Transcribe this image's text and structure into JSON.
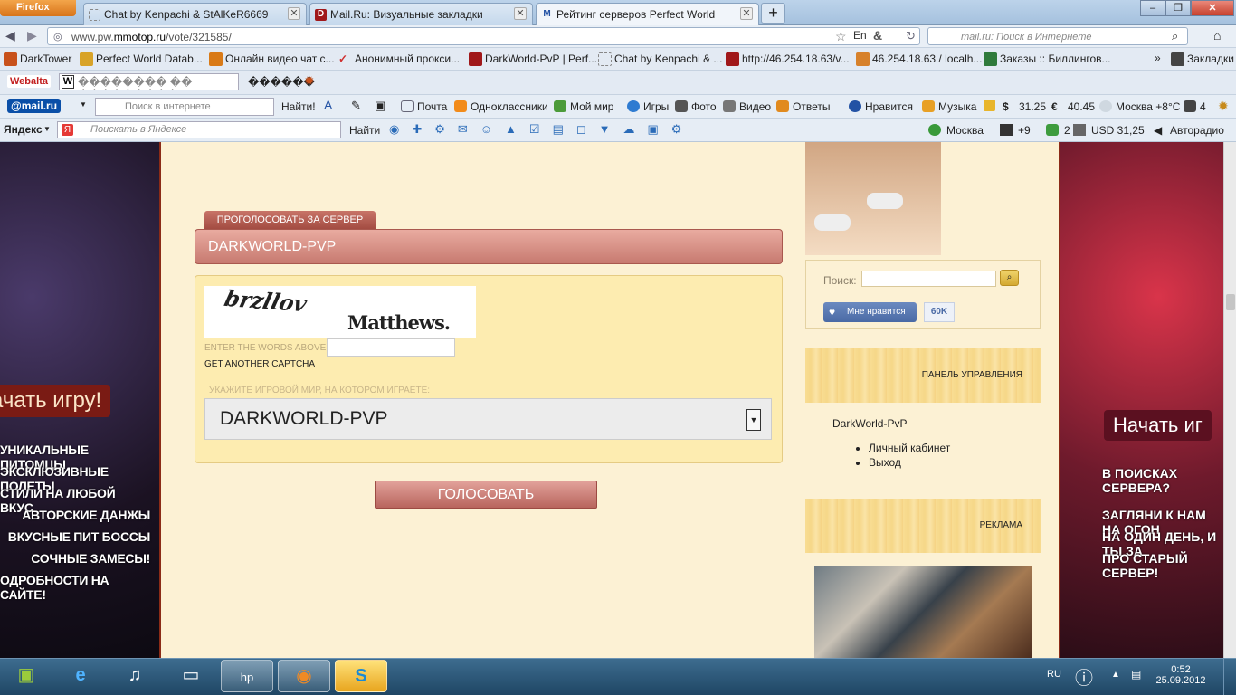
{
  "browser": {
    "menu_label": "Firefox",
    "tabs": [
      {
        "title": "Chat by Kenpachi & StAlKeR6669",
        "icon": "page-icon",
        "active": false
      },
      {
        "title": "Mail.Ru: Визуальные закладки",
        "icon": "dw-icon",
        "active": false
      },
      {
        "title": "Рейтинг серверов Perfect World",
        "icon": "m-icon",
        "active": true
      }
    ],
    "new_tab": "+",
    "window_buttons": [
      "–",
      "❐",
      "✕"
    ]
  },
  "navbar": {
    "url_prefix": "www.pw.",
    "url_domain": "mmotop.ru",
    "url_path": "/vote/321585/",
    "search_placeholder": "mail.ru: Поиск в Интернете"
  },
  "bookmarks": [
    {
      "label": "DarkTower",
      "color": "#c8511b"
    },
    {
      "label": "Perfect World Datab...",
      "color": "#d8a328"
    },
    {
      "label": "Онлайн видео чат с...",
      "color": "#d97a17"
    },
    {
      "label": "Анонимный прокси...",
      "color": "#cf2e2e"
    },
    {
      "label": "DarkWorld-PvP | Perf...",
      "color": "#a0181a"
    },
    {
      "label": "Chat by Kenpachi & ...",
      "color": "#ffffff"
    },
    {
      "label": "http://46.254.18.63/v...",
      "color": "#a0181a"
    },
    {
      "label": "46.254.18.63 / localh...",
      "color": "#d7812b"
    },
    {
      "label": "Заказы :: Биллингов...",
      "color": "#2f7a3b"
    }
  ],
  "bookmarks_more": "»",
  "bookmarks_folder": "Закладки",
  "webalta": {
    "logo": "Webalta",
    "field_text": "�������� �� ���������",
    "extra_text": "������"
  },
  "mailbar": {
    "logo": "@mail.ru",
    "search_placeholder": "Поиск в интернете",
    "find_label": "Найти!",
    "items": [
      "Почта",
      "Одноклассники",
      "Мой мир",
      "Игры",
      "Фото",
      "Видео",
      "Ответы"
    ],
    "right_items": [
      "Нравится",
      "Музыка",
      "31.25",
      "40.45",
      "Москва +8°C",
      "4"
    ]
  },
  "yabar": {
    "logo": "Яндекс",
    "search_placeholder": "Поискать в Яндексе",
    "find_label": "Найти",
    "right_items": [
      "Москва",
      "+9",
      "2",
      "USD 31,25",
      "Авторадио"
    ]
  },
  "left_banner": {
    "start_label": "ачать игру!",
    "promos": [
      "уникальные питомцы",
      "эксклюзивные полеты",
      "стили на любой вкус",
      "авторские данжы",
      "вкусные пит боссы",
      "сочные замесы!",
      "одробности на сайте!"
    ]
  },
  "right_banner": {
    "start_label": "Начать иг",
    "promos": [
      "В поисках сервера?",
      "Загляни к нам на огон",
      "на один день, и ты за",
      "про старый сервер!"
    ]
  },
  "vote": {
    "tab_label": "ПРОГОЛОСОВАТЬ ЗА СЕРВЕР",
    "server_name": "DARKWORLD-PVP",
    "captcha_word1": "brzllov",
    "captcha_word2": "Matthews.",
    "enter_label": "ENTER THE WORDS ABOVE:",
    "another_label": "GET ANOTHER CAPTCHA",
    "world_label": "УКАЖИТЕ ИГРОВОЙ МИР, НА КОТОРОМ ИГРАЕТЕ:",
    "world_selected": "DARKWORLD-PVP",
    "vote_button": "ГОЛОСОВАТЬ"
  },
  "sidebar": {
    "search_label": "Поиск:",
    "like_label": "Мне нравится",
    "like_count": "60K",
    "panel_title": "ПАНЕЛЬ УПРАВЛЕНИЯ",
    "user_link": "DarkWorld-PvP",
    "menu": [
      "Личный кабинет",
      "Выход"
    ],
    "ad_title": "РЕКЛАМА"
  },
  "taskbar": {
    "lang": "RU",
    "time": "0:52",
    "date": "25.09.2012"
  }
}
